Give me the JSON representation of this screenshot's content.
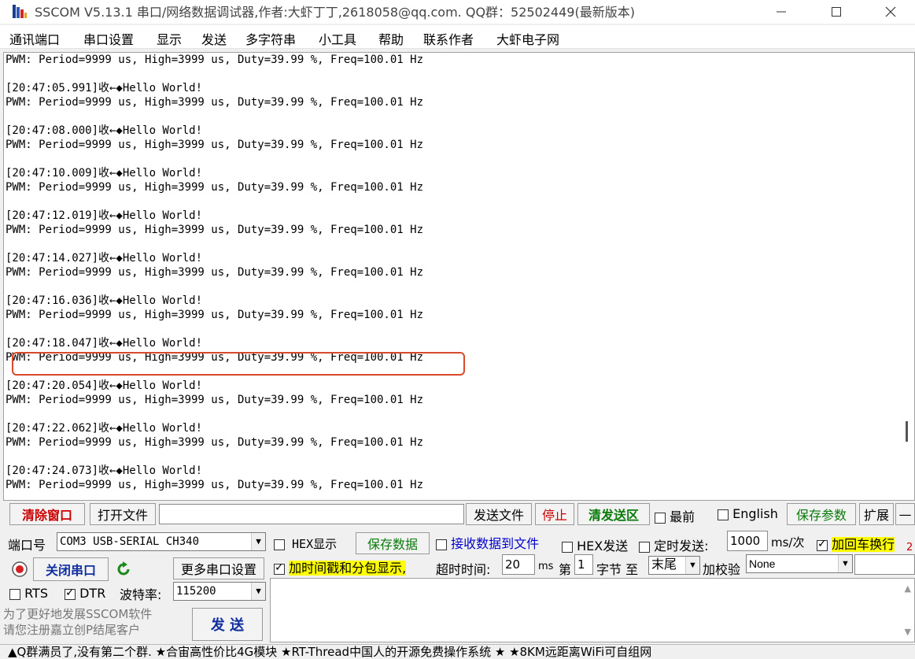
{
  "window": {
    "title": "SSCOM V5.13.1 串口/网络数据调试器,作者:大虾丁丁,2618058@qq.com. QQ群：52502449(最新版本)",
    "app_icon": "sscom-app-icon",
    "minimize_icon": "minimize-icon",
    "maximize_icon": "maximize-icon",
    "close_icon": "close-icon"
  },
  "menu": {
    "items": [
      "通讯端口",
      "串口设置",
      "显示",
      "发送",
      "多字符串",
      "小工具",
      "帮助",
      "联系作者",
      "大虾电子网"
    ]
  },
  "receive": {
    "lines": [
      "PWM: Period=9999 us, High=3999 us, Duty=39.99 %, Freq=100.01 Hz",
      "",
      "[20:47:05.991]收←◆Hello World!",
      "PWM: Period=9999 us, High=3999 us, Duty=39.99 %, Freq=100.01 Hz",
      "",
      "[20:47:08.000]收←◆Hello World!",
      "PWM: Period=9999 us, High=3999 us, Duty=39.99 %, Freq=100.01 Hz",
      "",
      "[20:47:10.009]收←◆Hello World!",
      "PWM: Period=9999 us, High=3999 us, Duty=39.99 %, Freq=100.01 Hz",
      "",
      "[20:47:12.019]收←◆Hello World!",
      "PWM: Period=9999 us, High=3999 us, Duty=39.99 %, Freq=100.01 Hz",
      "",
      "[20:47:14.027]收←◆Hello World!",
      "PWM: Period=9999 us, High=3999 us, Duty=39.99 %, Freq=100.01 Hz",
      "",
      "[20:47:16.036]收←◆Hello World!",
      "PWM: Period=9999 us, High=3999 us, Duty=39.99 %, Freq=100.01 Hz",
      "",
      "[20:47:18.047]收←◆Hello World!",
      "PWM: Period=9999 us, High=3999 us, Duty=39.99 %, Freq=100.01 Hz",
      "",
      "[20:47:20.054]收←◆Hello World!",
      "PWM: Period=9999 us, High=3999 us, Duty=39.99 %, Freq=100.01 Hz",
      "",
      "[20:47:22.062]收←◆Hello World!",
      "PWM: Period=9999 us, High=3999 us, Duty=39.99 %, Freq=100.01 Hz",
      "",
      "[20:47:24.073]收←◆Hello World!",
      "PWM: Period=9999 us, High=3999 us, Duty=39.99 %, Freq=100.01 Hz"
    ],
    "highlight_color": "#d94a2a"
  },
  "toolbar": {
    "clear_window": "清除窗口",
    "open_file": "打开文件",
    "file_path": "",
    "send_file": "发送文件",
    "stop": "停止",
    "clear_send": "清发送区",
    "topmost": "最前",
    "english": "English",
    "save_params": "保存参数",
    "expand": "扩展",
    "collapse": "—"
  },
  "port": {
    "port_label": "端口号",
    "port_value": "COM3 USB-SERIAL CH340",
    "close_port": "关闭串口",
    "more_settings": "更多串口设置",
    "rts": "RTS",
    "dtr": "DTR",
    "baud_label": "波特率:",
    "baud_value": "115200",
    "promo": "为了更好地发展SSCOM软件\n请您注册嘉立创P结尾客户",
    "promo_line1": "为了更好地发展SSCOM软件",
    "promo_line2": "请您注册嘉立创P结尾客户",
    "send": "发 送"
  },
  "options": {
    "hex_display": "HEX显示",
    "save_data": "保存数据",
    "recv_to_file": "接收数据到文件",
    "hex_send": "HEX发送",
    "timed_send": "定时发送:",
    "interval": "1000",
    "interval_unit": "ms/次",
    "add_crlf": "加回车换行",
    "timestamp": "加时间戳和分包显示,",
    "timeout_label": "超时时间:",
    "timeout_value": "20",
    "timeout_unit": "ms",
    "byte_prefix": "第",
    "byte_value": "1",
    "byte_suffix": "字节 至",
    "end_value": "末尾",
    "checksum_label": "加校验",
    "checksum_value": "None",
    "extra": "2"
  },
  "send_area": {
    "text": ""
  },
  "statusbar": {
    "text": "▲Q群满员了,没有第二个群. ★合宙高性价比4G模块 ★RT-Thread中国人的开源免费操作系统 ★ ★8KM远距离WiFi可自组网"
  },
  "colors": {
    "highlight_border": "#d94a2a",
    "yellow": "#ffff00",
    "green": "#0a7a0a",
    "red": "#cc0000"
  }
}
